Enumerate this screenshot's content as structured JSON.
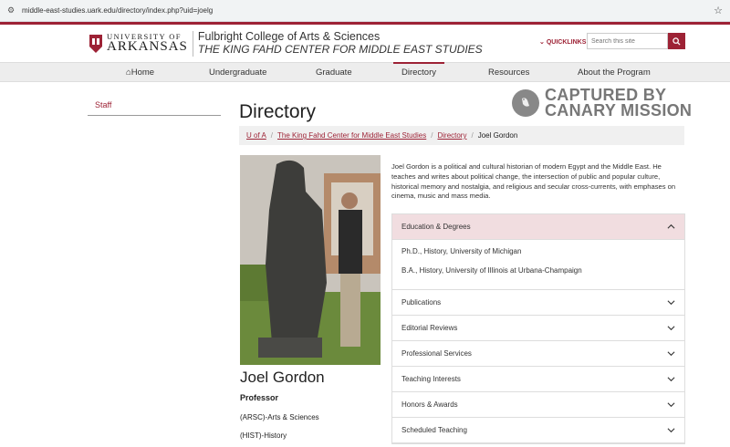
{
  "browser": {
    "url": "middle-east-studies.uark.edu/directory/index.php?uid=joelg"
  },
  "header": {
    "logo_line1": "UNIVERSITY OF",
    "logo_line2": "ARKANSAS",
    "college": "Fulbright College of Arts & Sciences",
    "center": "THE KING FAHD CENTER FOR MIDDLE EAST STUDIES",
    "quicklinks": "QUICKLINKS",
    "search_placeholder": "Search this site"
  },
  "nav": {
    "items": [
      "Home",
      "Undergraduate",
      "Graduate",
      "Directory",
      "Resources",
      "About the Program"
    ],
    "active": "Directory"
  },
  "sidebar": {
    "items": [
      "Staff"
    ]
  },
  "page_title": "Directory",
  "watermark": {
    "line1": "CAPTURED BY",
    "line2": "CANARY MISSION"
  },
  "breadcrumb": [
    "U of A",
    "The King Fahd Center for Middle East Studies",
    "Directory",
    "Joel Gordon"
  ],
  "profile": {
    "name": "Joel Gordon",
    "title": "Professor",
    "dept1": "(ARSC)-Arts & Sciences",
    "dept2": "(HIST)-History",
    "bio": "Joel Gordon is a political and cultural historian of modern Egypt and the Middle East. He teaches and writes about political change, the intersection of public and popular culture, historical memory and nostalgia, and religious and secular cross-currents, with emphases on cinema, music and mass media."
  },
  "accordion": {
    "open_label": "Education & Degrees",
    "degrees": [
      "Ph.D., History, University of Michigan",
      "B.A., History, University of Illinois at Urbana-Champaign"
    ],
    "sections": [
      "Publications",
      "Editorial Reviews",
      "Professional Services",
      "Teaching Interests",
      "Honors & Awards",
      "Scheduled Teaching"
    ]
  },
  "colors": {
    "accent": "#9d2235"
  }
}
